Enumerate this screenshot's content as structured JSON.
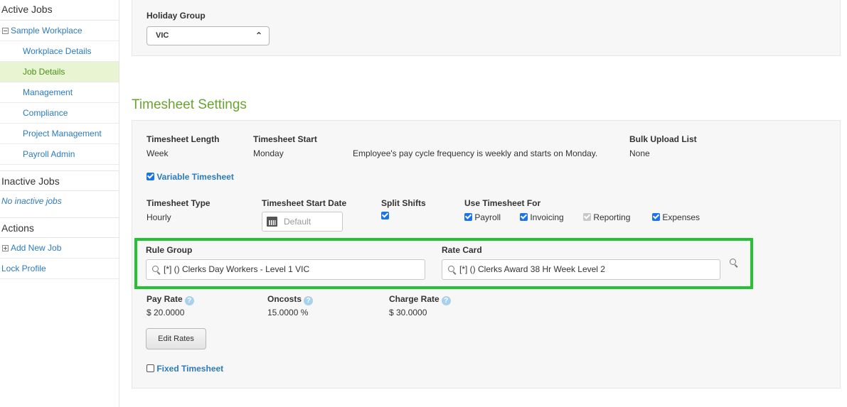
{
  "sidebar": {
    "active_jobs_heading": "Active Jobs",
    "workplace": "Sample Workplace",
    "items": [
      {
        "label": "Workplace Details"
      },
      {
        "label": "Job Details"
      },
      {
        "label": "Management"
      },
      {
        "label": "Compliance"
      },
      {
        "label": "Project Management"
      },
      {
        "label": "Payroll Admin"
      }
    ],
    "inactive_jobs_heading": "Inactive Jobs",
    "no_inactive": "No inactive jobs",
    "actions_heading": "Actions",
    "add_new_job": "Add New Job",
    "lock_profile": "Lock Profile"
  },
  "holiday": {
    "label": "Holiday Group",
    "value": "VIC"
  },
  "timesheet": {
    "section_title": "Timesheet Settings",
    "length_label": "Timesheet Length",
    "length_value": "Week",
    "start_label": "Timesheet Start",
    "start_value": "Monday",
    "cycle_note": "Employee's pay cycle frequency is weekly and starts on Monday.",
    "bulk_label": "Bulk Upload List",
    "bulk_value": "None",
    "variable_label": "Variable Timesheet",
    "type_label": "Timesheet Type",
    "type_value": "Hourly",
    "start_date_label": "Timesheet Start Date",
    "start_date_placeholder": "Default",
    "split_label": "Split Shifts",
    "use_for_label": "Use Timesheet For",
    "use_for": {
      "payroll": "Payroll",
      "invoicing": "Invoicing",
      "reporting": "Reporting",
      "expenses": "Expenses"
    },
    "rule_group_label": "Rule Group",
    "rule_group_value": "[*] () Clerks Day Workers - Level 1 VIC",
    "rate_card_label": "Rate Card",
    "rate_card_value": "[*] () Clerks Award 38 Hr Week Level 2",
    "pay_rate_label": "Pay Rate",
    "pay_rate_value": "$ 20.0000",
    "oncosts_label": "Oncosts",
    "oncosts_value": "15.0000 %",
    "charge_rate_label": "Charge Rate",
    "charge_rate_value": "$ 30.0000",
    "help_glyph": "?",
    "edit_rates": "Edit Rates",
    "fixed_label": "Fixed Timesheet"
  },
  "colors": {
    "accent_green": "#6aa42f",
    "link_blue": "#2b7bbd",
    "highlight_green": "#22c233",
    "active_bg": "#e9f5d2"
  }
}
